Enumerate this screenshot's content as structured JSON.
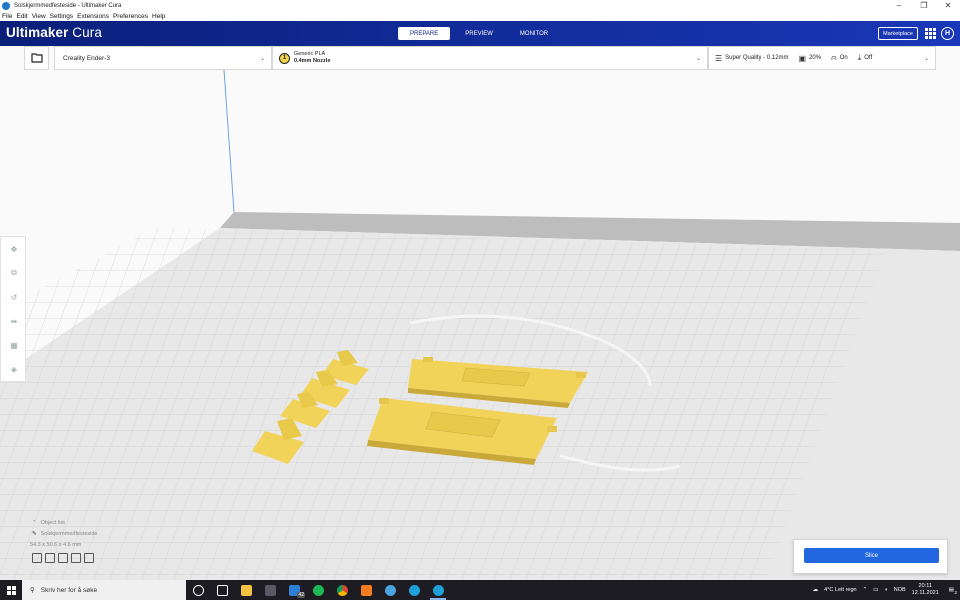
{
  "window": {
    "title": "Solskjermmedfesteside - Ultimaker Cura",
    "minimize": "–",
    "maximize": "❐",
    "close": "✕"
  },
  "menu": [
    "File",
    "Edit",
    "View",
    "Settings",
    "Extensions",
    "Preferences",
    "Help"
  ],
  "header": {
    "brand_bold": "Ultimaker",
    "brand_light": "Cura",
    "tabs": [
      {
        "label": "PREPARE",
        "active": true
      },
      {
        "label": "PREVIEW",
        "active": false
      },
      {
        "label": "MONITOR",
        "active": false
      }
    ],
    "marketplace": "Marketplace",
    "account_initial": "H"
  },
  "toolbar": {
    "printer": "Creality Ender-3",
    "material_badge": "1",
    "material_name": "Generic PLA",
    "nozzle": "0.4mm Nozzle",
    "quality": "Super Quality - 0.12mm",
    "infill": "20%",
    "support": "On",
    "adhesion": "Off"
  },
  "objects": {
    "header": "Object list",
    "item": "Solskjermmedfesteside",
    "dimensions": "54.3 x 50.6 x 4.6 mm"
  },
  "slice": {
    "label": "Slice"
  },
  "taskbar": {
    "search_placeholder": "Skriv her for å søke",
    "mail_badge": "42",
    "weather": "4°C  Lett regn",
    "language": "NOB",
    "time": "20:11",
    "date": "12.11.2021",
    "notification_count": "2"
  },
  "colors": {
    "header_start": "#0a1f7a",
    "header_end": "#1938b8",
    "model": "#f2d35a",
    "slice_button": "#2266e0"
  }
}
